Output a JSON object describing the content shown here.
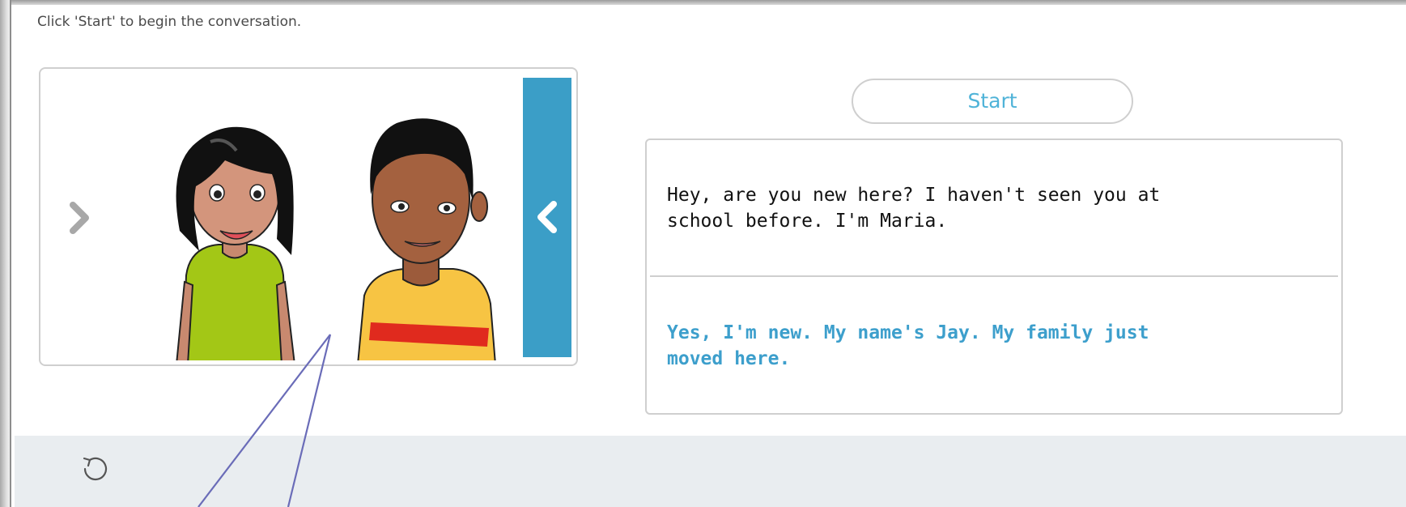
{
  "instruction": "Click 'Start' to begin the conversation.",
  "image_panel": {
    "prev_icon": "chevron-right-icon",
    "next_icon": "chevron-left-icon",
    "next_color": "#3b9ec7",
    "characters": [
      "girl-character",
      "boy-character"
    ]
  },
  "start_button": {
    "label": "Start"
  },
  "dialog": {
    "line_1": "Hey, are you new here? I haven't seen you at school before. I'm Maria.",
    "line_2": "Yes, I'm new. My name's Jay. My family just moved here.",
    "line_2_color": "#3d9fcc"
  },
  "footer": {
    "reset_icon": "reset-icon"
  }
}
